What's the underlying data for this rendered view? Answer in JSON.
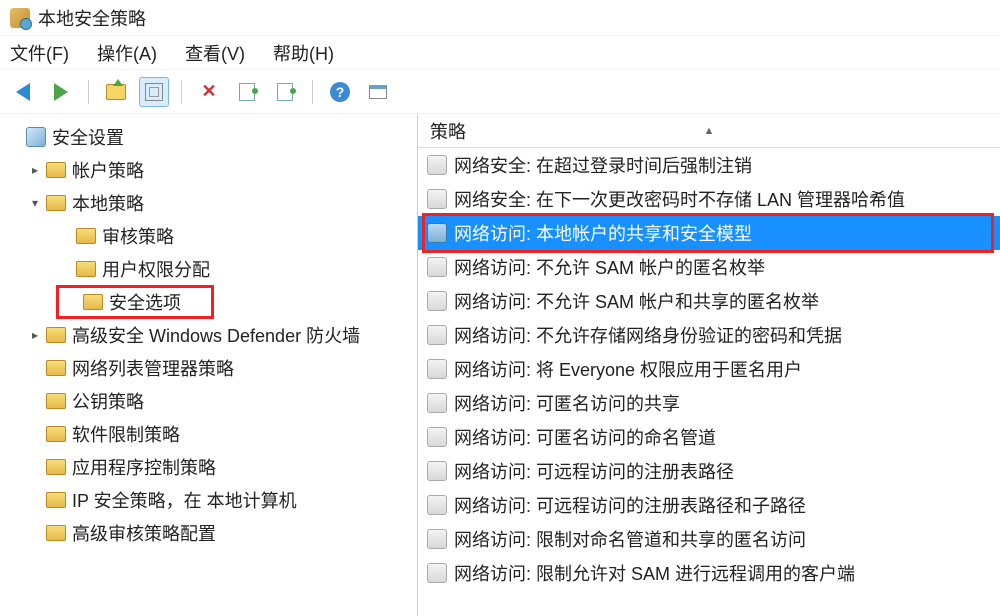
{
  "window": {
    "title": "本地安全策略"
  },
  "menu": {
    "file": "文件(F)",
    "action": "操作(A)",
    "view": "查看(V)",
    "help": "帮助(H)"
  },
  "toolbar": {
    "back": "back-arrow",
    "forward": "forward-arrow",
    "up": "folder-up",
    "show_hide": "show-hide-console-tree",
    "delete": "delete",
    "export": "export-list",
    "properties": "properties",
    "help": "help",
    "extra": "extra-window"
  },
  "tree": {
    "root": "安全设置",
    "items": [
      {
        "label": "帐户策略",
        "level": 1,
        "twisty": ">"
      },
      {
        "label": "本地策略",
        "level": 1,
        "twisty": "v"
      },
      {
        "label": "审核策略",
        "level": 2
      },
      {
        "label": "用户权限分配",
        "level": 2
      },
      {
        "label": "安全选项",
        "level": 2,
        "highlight": true
      },
      {
        "label": "高级安全 Windows Defender 防火墙",
        "level": 1,
        "twisty": ">"
      },
      {
        "label": "网络列表管理器策略",
        "level": 1
      },
      {
        "label": "公钥策略",
        "level": 1
      },
      {
        "label": "软件限制策略",
        "level": 1
      },
      {
        "label": "应用程序控制策略",
        "level": 1
      },
      {
        "label": "IP 安全策略，在 本地计算机",
        "level": 1,
        "shield": true
      },
      {
        "label": "高级审核策略配置",
        "level": 1
      }
    ]
  },
  "right": {
    "header": "策略",
    "sort_indicator": "▲",
    "policies": [
      "网络安全: 在超过登录时间后强制注销",
      "网络安全: 在下一次更改密码时不存储 LAN 管理器哈希值",
      "网络访问: 本地帐户的共享和安全模型",
      "网络访问: 不允许 SAM 帐户的匿名枚举",
      "网络访问: 不允许 SAM 帐户和共享的匿名枚举",
      "网络访问: 不允许存储网络身份验证的密码和凭据",
      "网络访问: 将 Everyone 权限应用于匿名用户",
      "网络访问: 可匿名访问的共享",
      "网络访问: 可匿名访问的命名管道",
      "网络访问: 可远程访问的注册表路径",
      "网络访问: 可远程访问的注册表路径和子路径",
      "网络访问: 限制对命名管道和共享的匿名访问",
      "网络访问: 限制允许对 SAM 进行远程调用的客户端"
    ],
    "selected_index": 2
  }
}
